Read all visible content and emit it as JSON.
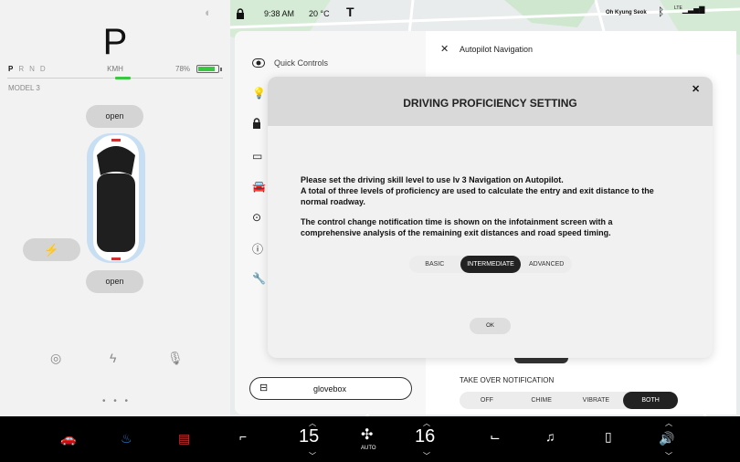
{
  "left": {
    "gear": "P",
    "gears": [
      "P",
      "R",
      "N",
      "D"
    ],
    "unit": "KMH",
    "battery_pct": "78%",
    "battery_fill": 0.78,
    "model": "MODEL 3",
    "frunk_label": "open",
    "trunk_label": "open",
    "dots": "• • •"
  },
  "status": {
    "time": "9:38 AM",
    "temperature": "20 °C",
    "user": "Oh Kyung Seok",
    "signal_label": "LTE"
  },
  "menu": {
    "quick_controls": "Quick Controls",
    "glovebox": "glovebox"
  },
  "panel": {
    "title": "Autopilot Navigation",
    "takeover_title": "TAKE OVER NOTIFICATION",
    "takeover_options": [
      "OFF",
      "CHIME",
      "VIBRATE",
      "BOTH"
    ],
    "takeover_selected": "BOTH"
  },
  "modal": {
    "title": "DRIVING PROFICIENCY SETTING",
    "para1_line1": "Please set the driving skill level to use lv 3 Navigation on Autopilot.",
    "para1_line2": "A total of three levels of proficiency are used to calculate the entry and exit distance to the",
    "para1_line3": "normal roadway.",
    "para2_line1": "The control change notification time is shown on the infotainment screen with a",
    "para2_line2": "comprehensive analysis of the remaining exit distances and road speed timing.",
    "levels": [
      "BASIC",
      "INTERMEDIATE",
      "ADVANCED"
    ],
    "selected_level": "INTERMEDIATE",
    "ok_label": "OK"
  },
  "bottom": {
    "temp_left": "15",
    "temp_right": "16",
    "fan_label": "AUTO"
  },
  "colors": {
    "battery": "#39c640",
    "defrost_front": "#2a7fd4",
    "defrost_rear": "#d42a2a"
  }
}
